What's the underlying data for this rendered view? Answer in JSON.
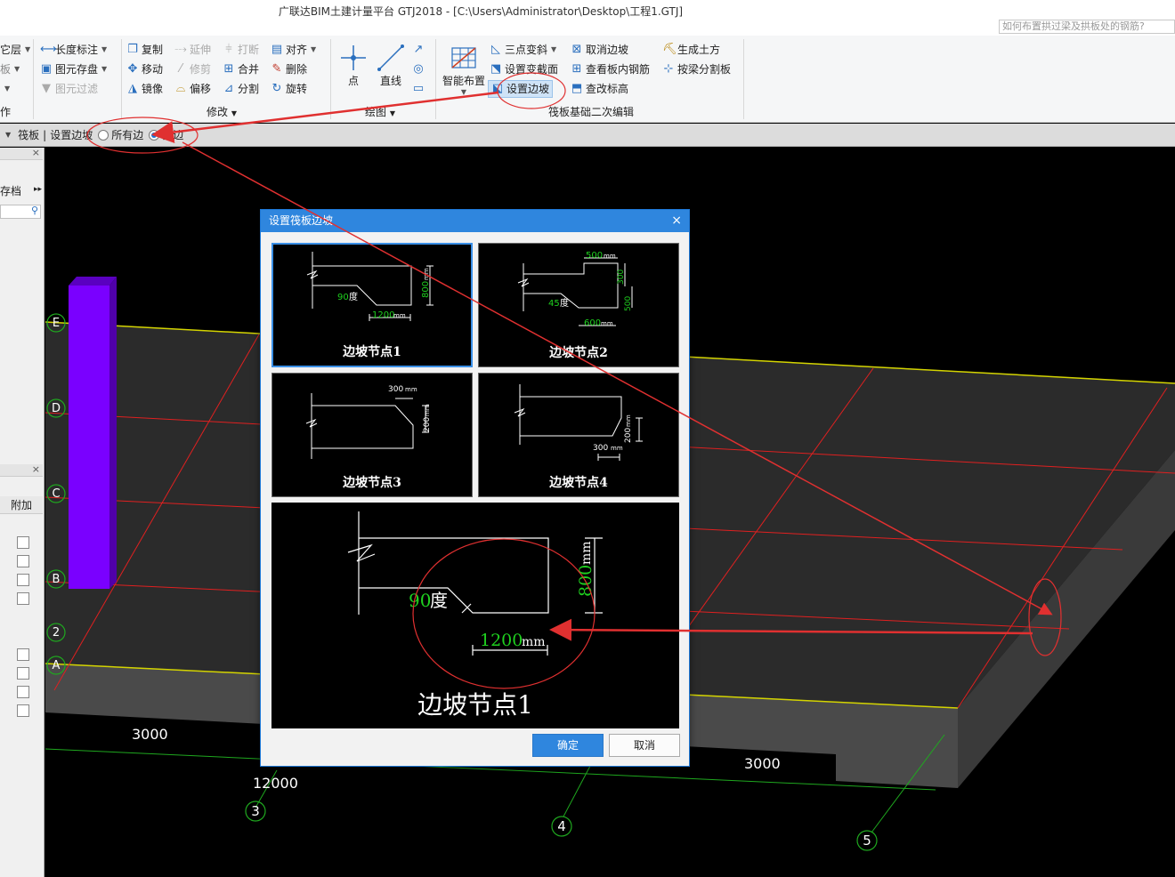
{
  "window": {
    "title": "广联达BIM土建计量平台 GTJ2018 - [C:\\Users\\Administrator\\Desktop\\工程1.GTJ]",
    "help_search_placeholder": "如何布置拱过梁及拱板处的钢筋?"
  },
  "ribbon": {
    "left_col": [
      {
        "label": "它层",
        "arrow": true
      },
      {
        "label": "板",
        "arrow": true
      },
      {
        "label": "",
        "arrow": true
      }
    ],
    "left_group_label": "作",
    "col2": [
      {
        "label": "长度标注",
        "arrow": true,
        "disabled": false
      },
      {
        "label": "图元存盘",
        "arrow": true,
        "disabled": false
      },
      {
        "label": "图元过滤",
        "arrow": false,
        "disabled": true
      }
    ],
    "modify": {
      "items": [
        {
          "label": "复制",
          "disabled": false,
          "icon": "copy-icon"
        },
        {
          "label": "延伸",
          "disabled": true,
          "icon": "extend-icon"
        },
        {
          "label": "打断",
          "disabled": true,
          "icon": "break-icon"
        },
        {
          "label": "对齐",
          "disabled": false,
          "icon": "align-icon",
          "arrow": true
        },
        {
          "label": "移动",
          "disabled": false,
          "icon": "move-icon"
        },
        {
          "label": "修剪",
          "disabled": true,
          "icon": "trim-icon"
        },
        {
          "label": "合并",
          "disabled": false,
          "icon": "merge-icon"
        },
        {
          "label": "删除",
          "disabled": false,
          "icon": "delete-icon"
        },
        {
          "label": "镜像",
          "disabled": false,
          "icon": "mirror-icon"
        },
        {
          "label": "偏移",
          "disabled": false,
          "icon": "offset-icon"
        },
        {
          "label": "分割",
          "disabled": false,
          "icon": "split-icon"
        },
        {
          "label": "旋转",
          "disabled": false,
          "icon": "rotate-icon"
        }
      ],
      "group_label": "修改"
    },
    "draw": {
      "point_label": "点",
      "line_label": "直线",
      "group_label": "绘图"
    },
    "raft": {
      "smart_layout_label": "智能布置",
      "items": [
        {
          "label": "三点变斜",
          "arrow": true,
          "icon": "three-point-slope-icon"
        },
        {
          "label": "取消边坡",
          "icon": "cancel-slope-icon"
        },
        {
          "label": "生成土方",
          "icon": "earthwork-icon"
        },
        {
          "label": "设置变截面",
          "icon": "variable-section-icon"
        },
        {
          "label": "查看板内钢筋",
          "icon": "view-rebar-icon"
        },
        {
          "label": "按梁分割板",
          "icon": "split-by-beam-icon"
        },
        {
          "label": "设置边坡",
          "icon": "set-slope-icon",
          "active": true
        },
        {
          "label": "查改标高",
          "icon": "elevation-icon"
        }
      ],
      "group_label": "筏板基础二次编辑"
    }
  },
  "toolbar": {
    "context": "筏板",
    "separator": "|",
    "command": "设置边坡",
    "option_all": "所有边",
    "option_multi": "多边",
    "selected": "multi"
  },
  "left_panel": {
    "save_label": "存档",
    "attach_header": "附加"
  },
  "viewport": {
    "axis_letters": [
      "E",
      "D",
      "C",
      "B",
      "2",
      "A"
    ],
    "axis_numbers": [
      "3",
      "4",
      "5"
    ],
    "dims": {
      "d1": "3000",
      "d2": "12000",
      "d3": "3000"
    }
  },
  "dialog": {
    "title": "设置筏板边坡",
    "tiles": [
      {
        "label": "边坡节点1",
        "angle": "90",
        "angle_unit": "度",
        "height": "800",
        "width": "1200",
        "unit": "mm"
      },
      {
        "label": "边坡节点2",
        "angle": "45",
        "angle_unit": "度",
        "top_width": "500",
        "step_height": "300",
        "height": "500",
        "width": "600",
        "unit": "mm"
      },
      {
        "label": "边坡节点3",
        "top_width": "300",
        "height": "200",
        "unit": "mm"
      },
      {
        "label": "边坡节点4",
        "width": "300",
        "height": "200",
        "unit": "mm"
      }
    ],
    "preview": {
      "label": "边坡节点1",
      "angle": "90",
      "angle_unit": "度",
      "height": "800",
      "width": "1200",
      "unit": "mm"
    },
    "ok_label": "确定",
    "cancel_label": "取消"
  }
}
